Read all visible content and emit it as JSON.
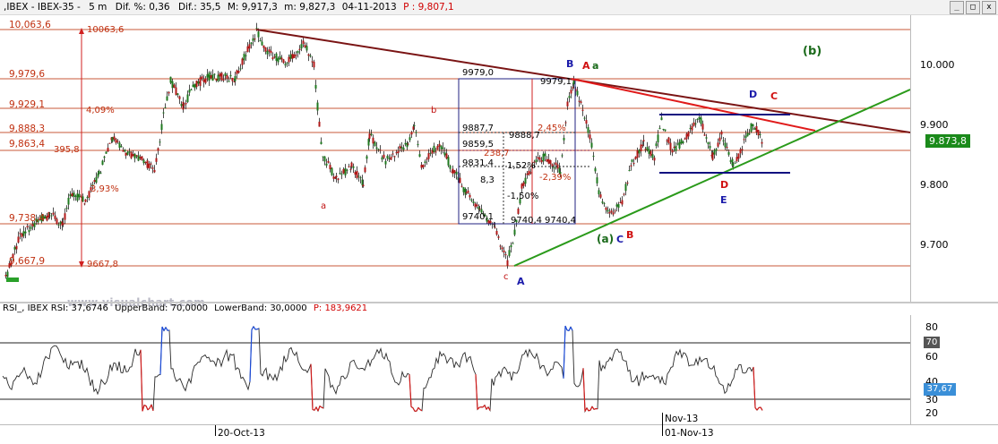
{
  "header": {
    "symbol": ",IBEX - IBEX-35 -",
    "interval": "5 m",
    "dif_pct_label": "Dif. %: 0,36",
    "dif_label": "Dif.: 35,5",
    "max_label": "M: 9,917,3",
    "min_label": "m: 9,827,3",
    "date_label": "04-11-2013",
    "price_label": "P : 9,807,1"
  },
  "window_controls": [
    "_",
    "□",
    "x"
  ],
  "price_axis": {
    "ticks": [
      "10.000",
      "9.900",
      "9.800",
      "9.700"
    ],
    "current_value": "9.873,8",
    "current_color": "#1a8a1a"
  },
  "horizontal_levels": [
    {
      "label": "10,063,6"
    },
    {
      "label": "9,979,6"
    },
    {
      "label": "9,929,1"
    },
    {
      "label": "9,888,3"
    },
    {
      "label": "9,863,4"
    },
    {
      "label": "9,738,4"
    },
    {
      "label": "9,667,9"
    }
  ],
  "annotations": {
    "range_top": "10063,6",
    "range_bottom": "9667,8",
    "pct_4_09": "4,09%",
    "pct_3_93": "3,93%",
    "val_395_8": "395,8",
    "box_9979": "9979,0",
    "box_9979b": "9979,1",
    "box_9887": "9887,7",
    "box_9888": "9888,7",
    "box_9859": "9859,5",
    "box_9831": "9831,4",
    "box_8_3": "8,3",
    "box_9740a": "9740,1",
    "box_9740b": "9740,4",
    "box_9740c": "9740,4",
    "pct_2_45": "2,45%",
    "pct_1_52": "1,52%",
    "pct_neg_2_39": "-2,39%",
    "pct_neg_1_50": "-1,50%",
    "val_238_7": "238,7"
  },
  "wave_labels": {
    "b_big": "(b)",
    "a_paren": "(a)",
    "C_blue_1": "C",
    "B_red": "B",
    "B_blue": "B",
    "A_red": "A",
    "a_green": "a",
    "D_blue_top": "D",
    "C_red_top": "C",
    "D_red": "D",
    "E_blue": "E",
    "b_small": "b",
    "a_small": "a",
    "c_small": "c",
    "A_blue": "A"
  },
  "watermark": "www.visualchart.com",
  "rsi": {
    "title": "RSI_, IBEX RSI: 37,6746",
    "upper_label": "UpperBand: 70,0000",
    "lower_label": "LowerBand: 30,0000",
    "p_label": "P: 183,9621",
    "ticks": [
      "80",
      "70",
      "60",
      "40",
      "30",
      "20"
    ],
    "current_value": "37,67",
    "upper_badge": "70",
    "lower_badge": "30"
  },
  "dates": {
    "d1": "20-Oct-13",
    "d2_top": "Nov-13",
    "d2": "01-Nov-13"
  },
  "colors": {
    "level_line": "#c85a3a",
    "trend_dark": "#7a1414",
    "trend_red": "#e01a1a",
    "trend_green": "#2a9a1a",
    "channel_blue": "#101080",
    "candle_up": "#1f7a1f",
    "candle_down": "#b01818"
  }
}
